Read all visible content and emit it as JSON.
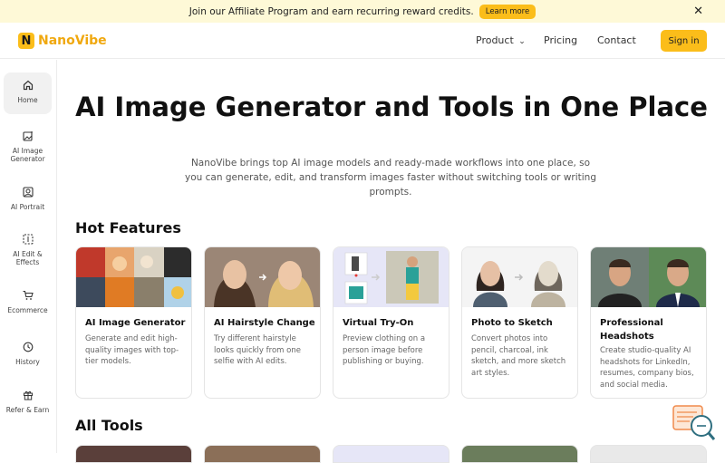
{
  "banner": {
    "text": "Join our Affiliate Program and earn recurring reward credits.",
    "button": "Learn more"
  },
  "header": {
    "brand": "NanoVibe",
    "nav": {
      "product": "Product",
      "pricing": "Pricing",
      "contact": "Contact"
    },
    "signin": "Sign in"
  },
  "sidebar": {
    "items": [
      {
        "label": "Home",
        "icon": "home-icon"
      },
      {
        "label": "AI Image Generator",
        "icon": "image-sparkle-icon"
      },
      {
        "label": "AI Portrait",
        "icon": "portrait-icon"
      },
      {
        "label": "AI Edit & Effects",
        "icon": "edit-effects-icon"
      },
      {
        "label": "Ecommerce",
        "icon": "cart-icon"
      },
      {
        "label": "History",
        "icon": "history-icon"
      },
      {
        "label": "Refer & Earn",
        "icon": "gift-icon"
      }
    ]
  },
  "hero": {
    "title": "AI Image Generator and Tools in One Place",
    "subtitle": "NanoVibe brings top AI image models and ready-made workflows into one place, so you can generate, edit, and transform images faster without switching tools or writing prompts."
  },
  "hot_features": {
    "title": "Hot Features",
    "cards": [
      {
        "title": "AI Image Generator",
        "desc": "Generate and edit high-quality images with top-tier models."
      },
      {
        "title": "AI Hairstyle Change",
        "desc": "Try different hairstyle looks quickly from one selfie with AI edits."
      },
      {
        "title": "Virtual Try-On",
        "desc": "Preview clothing on a person image before publishing or buying."
      },
      {
        "title": "Photo to Sketch",
        "desc": "Convert photos into pencil, charcoal, ink sketch, and more sketch art styles."
      },
      {
        "title": "Professional Headshots",
        "desc": "Create studio-quality AI headshots for LinkedIn, resumes, company bios, and social media."
      }
    ]
  },
  "all_tools": {
    "title": "All Tools"
  },
  "colors": {
    "accent": "#fbbd1a",
    "brand_text": "#f0a80f",
    "banner_bg": "#fef9d7"
  }
}
